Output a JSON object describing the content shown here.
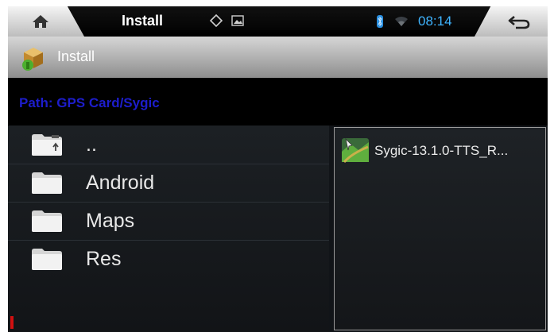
{
  "status_bar": {
    "title": "Install",
    "time": "08:14",
    "home_icon": "home-icon",
    "back_icon": "back-arrow-icon"
  },
  "title_bar": {
    "title": "Install",
    "icon": "package-install-icon"
  },
  "path": {
    "text": "Path: GPS Card/Sygic"
  },
  "folders": [
    {
      "name": "..",
      "icon": "parent-folder-icon"
    },
    {
      "name": "Android",
      "icon": "folder-icon"
    },
    {
      "name": "Maps",
      "icon": "folder-icon"
    },
    {
      "name": "Res",
      "icon": "folder-icon"
    }
  ],
  "files": [
    {
      "name": "Sygic-13.1.0-TTS_R...",
      "icon": "sygic-app-icon"
    }
  ],
  "colors": {
    "accent_blue": "#3fb4ff",
    "path_blue": "#1d1dcc"
  }
}
